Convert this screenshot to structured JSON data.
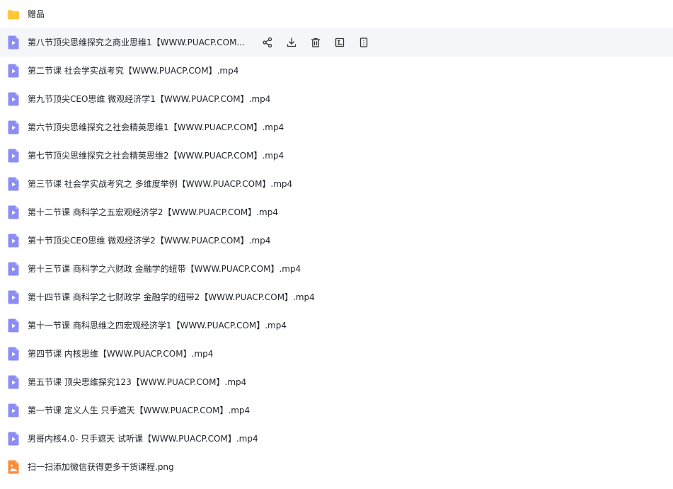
{
  "colors": {
    "folder": "#FFC53D",
    "video": "#8C8CF5",
    "image": "#FF8A34",
    "hover_bg": "#F5F6FA",
    "action_icon": "#333333"
  },
  "files": [
    {
      "name": "赠品",
      "type": "folder"
    },
    {
      "name": "第八节顶尖思维探究之商业思维1【WWW.PUACP.COM...",
      "type": "video",
      "hovered": true
    },
    {
      "name": "第二节课 社会学实战考究【WWW.PUACP.COM】.mp4",
      "type": "video"
    },
    {
      "name": "第九节顶尖CEO思维 微观经济学1【WWW.PUACP.COM】.mp4",
      "type": "video"
    },
    {
      "name": "第六节顶尖思维探究之社会精英思维1【WWW.PUACP.COM】.mp4",
      "type": "video"
    },
    {
      "name": "第七节顶尖思维探究之社会精英思维2【WWW.PUACP.COM】.mp4",
      "type": "video"
    },
    {
      "name": "第三节课 社会学实战考究之 多维度举例【WWW.PUACP.COM】.mp4",
      "type": "video"
    },
    {
      "name": "第十二节课 商科学之五宏观经济学2【WWW.PUACP.COM】.mp4",
      "type": "video"
    },
    {
      "name": "第十节顶尖CEO思维 微观经济学2【WWW.PUACP.COM】.mp4",
      "type": "video"
    },
    {
      "name": "第十三节课 商科学之六财政 金融学的纽带【WWW.PUACP.COM】.mp4",
      "type": "video"
    },
    {
      "name": "第十四节课 商科学之七财政学 金融学的纽带2【WWW.PUACP.COM】.mp4",
      "type": "video"
    },
    {
      "name": "第十一节课 商科思维之四宏观经济学1【WWW.PUACP.COM】.mp4",
      "type": "video"
    },
    {
      "name": "第四节课 内核思维【WWW.PUACP.COM】.mp4",
      "type": "video"
    },
    {
      "name": "第五节课 顶尖思维探究123【WWW.PUACP.COM】.mp4",
      "type": "video"
    },
    {
      "name": "第一节课 定义人生 只手遮天【WWW.PUACP.COM】.mp4",
      "type": "video"
    },
    {
      "name": "男哥内核4.0- 只手遮天 试听课【WWW.PUACP.COM】.mp4",
      "type": "video"
    },
    {
      "name": "扫一扫添加微信获得更多干货课程.png",
      "type": "image"
    }
  ],
  "row_actions": [
    {
      "icon": "share-icon"
    },
    {
      "icon": "download-icon"
    },
    {
      "icon": "delete-icon"
    },
    {
      "icon": "rename-icon"
    },
    {
      "icon": "more-icon"
    }
  ]
}
